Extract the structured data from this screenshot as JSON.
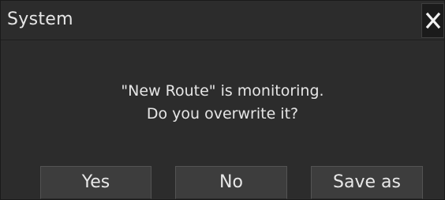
{
  "window": {
    "title": "System",
    "close_icon": "close-icon"
  },
  "message": {
    "line1": "\"New Route\" is monitoring.",
    "line2": "Do you overwrite it?"
  },
  "buttons": {
    "yes": "Yes",
    "no": "No",
    "save_as": "Save as"
  },
  "colors": {
    "background": "#2c2c2c",
    "text": "#e6e6e6",
    "button": "#3d3d3d"
  }
}
